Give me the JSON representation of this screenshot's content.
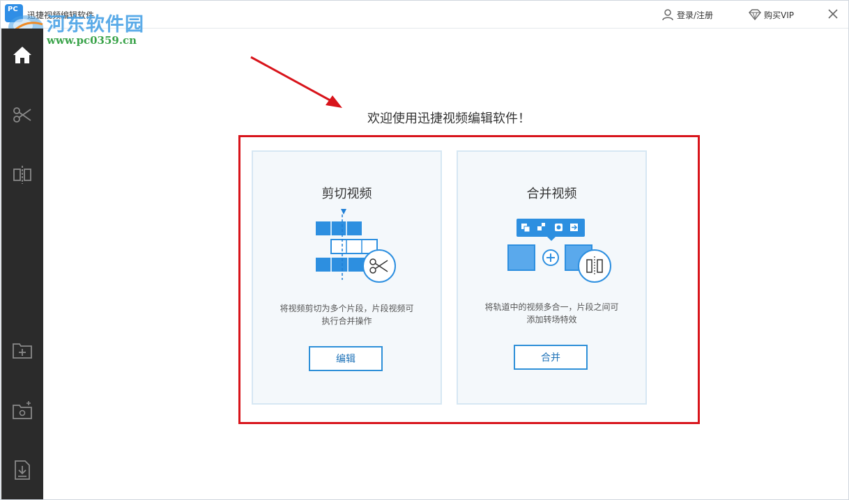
{
  "window": {
    "title": "迅捷视频编辑软件",
    "app_icon_text": "PC",
    "login_label": "登录/注册",
    "vip_label": "购买VIP"
  },
  "watermark": {
    "name": "河东软件园",
    "url": "www.pc0359.cn"
  },
  "sidebar": {
    "items": [
      {
        "name": "home",
        "icon": "home-icon",
        "active": true
      },
      {
        "name": "cut",
        "icon": "scissors-icon",
        "active": false
      },
      {
        "name": "merge",
        "icon": "split-merge-icon",
        "active": false
      },
      {
        "name": "add-folder",
        "icon": "folder-add-icon",
        "active": false
      },
      {
        "name": "folder-settings",
        "icon": "folder-settings-icon",
        "active": false
      },
      {
        "name": "export",
        "icon": "file-download-icon",
        "active": false
      }
    ]
  },
  "main": {
    "welcome": "欢迎使用迅捷视频编辑软件！",
    "cards": [
      {
        "title": "剪切视频",
        "desc_line1": "将视频剪切为多个片段，片段视频可",
        "desc_line2": "执行合并操作",
        "button": "编辑"
      },
      {
        "title": "合并视频",
        "desc_line1": "将轨道中的视频多合一，片段之间可",
        "desc_line2": "添加转场特效",
        "button": "合并"
      }
    ]
  },
  "colors": {
    "accent": "#2d8fd8",
    "sidebar_bg": "#2b2b2b",
    "highlight_red": "#d8141b",
    "card_bg": "#f4f8fb"
  }
}
